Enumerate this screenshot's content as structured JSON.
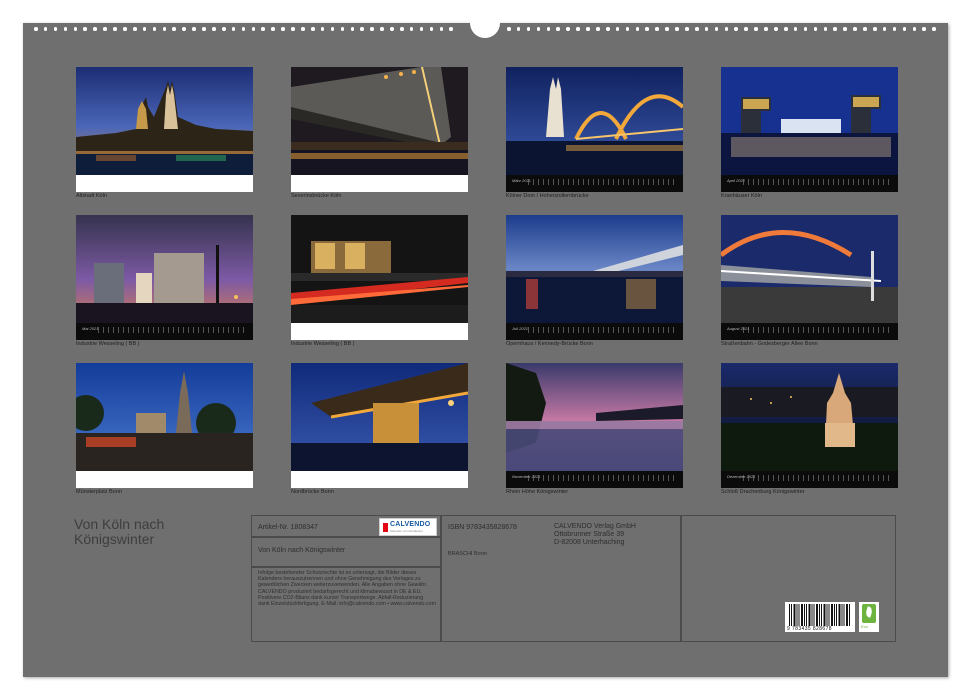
{
  "calendar": {
    "title": "Von Köln nach Königswinter",
    "thumbnails": [
      {
        "caption": "Altstadt Köln",
        "month": ""
      },
      {
        "caption": "Severinsbrücke Köln",
        "month": ""
      },
      {
        "caption": "Kölner Dom / Hohenzollernbrücke",
        "month": "März 2021"
      },
      {
        "caption": "Kranhäuser Köln",
        "month": "April 2021"
      },
      {
        "caption": "Industrie Wesseling ( BB )",
        "month": "Mai 2021"
      },
      {
        "caption": "Industrie Wesseling ( BB )",
        "month": ""
      },
      {
        "caption": "Opernhaus / Kennedy-Brücke Bonn",
        "month": "Juli 2021"
      },
      {
        "caption": "Straßenbahn - Godesberger Allee Bonn",
        "month": "August 2021"
      },
      {
        "caption": "Münsterplatz Bonn",
        "month": ""
      },
      {
        "caption": "Nordbrücke Bonn",
        "month": ""
      },
      {
        "caption": "Rhein Höhe Königswinter",
        "month": "November 2021"
      },
      {
        "caption": "Schloß Drachenburg Königswinter",
        "month": "Dezember 2021"
      }
    ],
    "info": {
      "article": "Artikel-Nr. 1808347",
      "publisher_logo": "CALVENDO",
      "publisher_logo_sub": "Kalender vom Entdecker",
      "title": "Von Köln nach Königswinter",
      "legal": "Infolge bestehender Schutzrechte ist es untersagt, die Bilder dieses Kalenders herauszutrennen und ohne Genehmigung des Verlages zu gewerblichen Zwecken weiterzuverwenden. Alle Angaben ohne Gewähr. CALVENDO produziert bedarfsgerecht und klimabewusst in DE & EU. Positivere CO2-Bilanz dank kurzer Transportwege. Abfall-Reduzierung dank Einzelstückfertigung. E-Mail: info@calvendo.com • www.calvendo.com",
      "isbn": "ISBN 9783435828678",
      "author": "BRASCHI Bonn",
      "publisher_name": "CALVENDO Verlag GmbH",
      "publisher_street": "Ottobrunner Straße 39",
      "publisher_city": "D-82008 Unterhaching",
      "barcode_number": "9 783435 828678",
      "eco_label": "Eco"
    }
  }
}
